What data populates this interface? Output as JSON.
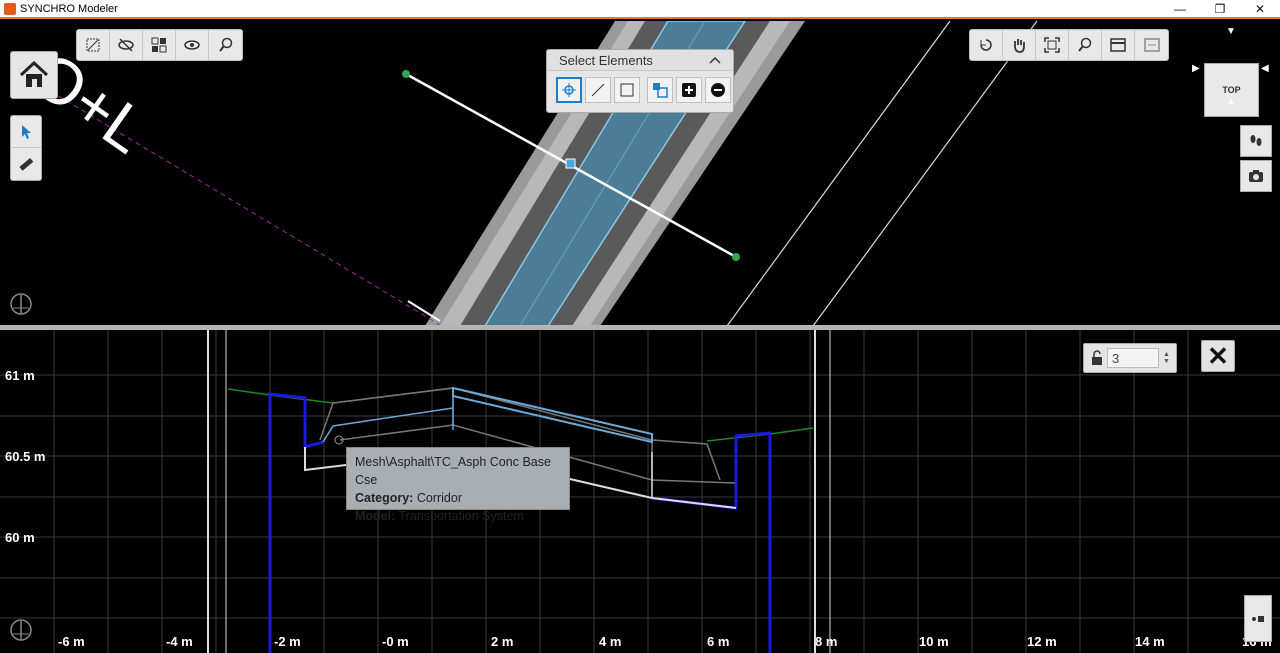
{
  "window": {
    "title": "SYNCHRO Modeler",
    "controls": {
      "minimize": "—",
      "restore": "❐",
      "close": "✕"
    }
  },
  "viewport": {
    "overlay_text": "O+L",
    "nav_cube_face": "TOP",
    "select_panel": {
      "title": "Select Elements"
    },
    "toolbar_left": [
      "section-tool",
      "visibility-off",
      "isolate",
      "hide-others",
      "find"
    ],
    "toolbar_right": [
      "undo-view",
      "pan",
      "fit-view",
      "zoom-window",
      "clip-view",
      "section-toggle"
    ],
    "colors": {
      "road_surface": "#4b7e96",
      "road_edge": "#8cc8e6",
      "pavement_gray": "#9a9a9a"
    }
  },
  "section": {
    "y_labels": [
      "61 m",
      "60.5 m",
      "60 m"
    ],
    "x_labels": [
      "-6 m",
      "-4 m",
      "-2 m",
      "-0 m",
      "2 m",
      "4 m",
      "6 m",
      "8 m",
      "10 m",
      "12 m",
      "14 m",
      "16 m"
    ],
    "lock_value": "3",
    "tooltip": {
      "name": "Mesh\\Asphalt\\TC_Asph Conc Base Cse",
      "category_label": "Category:",
      "category": "Corridor",
      "model_label": "Model:",
      "model": "Transportation System"
    },
    "colors": {
      "blue_line": "#1a1adc",
      "green_line": "#1e8a1e",
      "grid": "#3a3a3a"
    }
  }
}
